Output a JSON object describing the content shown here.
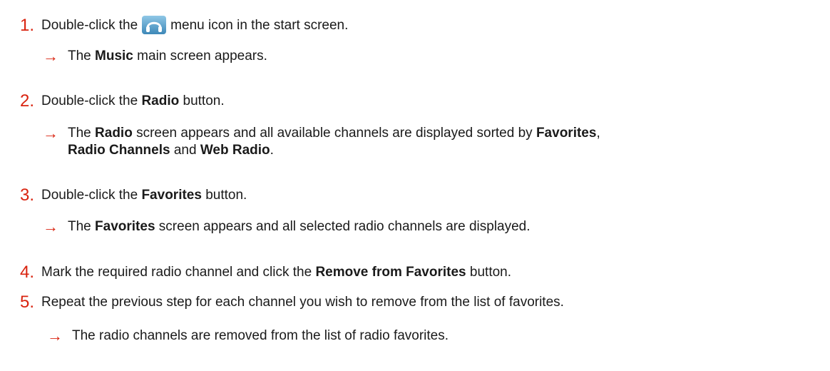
{
  "steps": [
    {
      "number": "1.",
      "text_before_icon": "Double-click the",
      "icon": "headphones-icon",
      "text_after_icon": "menu icon in the start screen.",
      "result": {
        "t1": "The ",
        "b1": "Music",
        "t2": " main screen appears."
      }
    },
    {
      "number": "2.",
      "t1": "Double-click the ",
      "b1": "Radio",
      "t2": " button.",
      "result": {
        "t1": "The ",
        "b1": "Radio",
        "t2": " screen appears and all available channels are displayed sorted by ",
        "b2": "Favorites",
        "t3": ",",
        "b3": "Radio Channels",
        "t4": " and ",
        "b4": "Web Radio",
        "t5": "."
      }
    },
    {
      "number": "3.",
      "t1": "Double-click the ",
      "b1": "Favorites",
      "t2": " button.",
      "result": {
        "t1": "The ",
        "b1": "Favorites",
        "t2": " screen appears and all selected radio channels are displayed."
      }
    },
    {
      "number": "4.",
      "t1": "Mark the required radio channel and click the ",
      "b1": "Remove from Favorites",
      "t2": " button."
    },
    {
      "number": "5.",
      "t1": "Repeat the previous step for each channel you wish to remove from the list of favorites.",
      "result": {
        "t1": "The radio channels are removed from the list of radio favorites."
      }
    }
  ],
  "arrow_glyph": "→",
  "colors": {
    "accent": "#d9230f",
    "text": "#1a1a1a",
    "icon_top": "#8fc7e6",
    "icon_bottom": "#3d88b8"
  }
}
